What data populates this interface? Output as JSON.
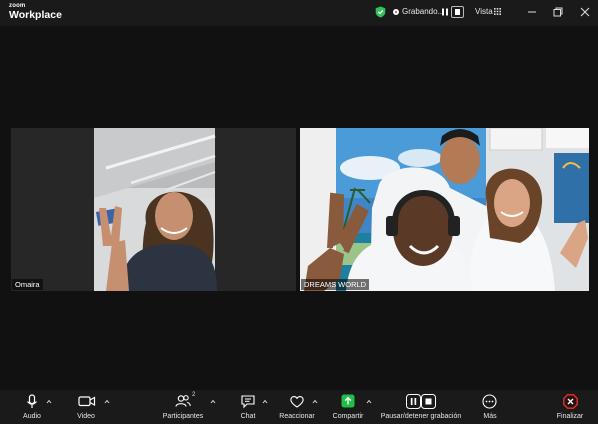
{
  "titlebar": {
    "brand_small": "zoom",
    "brand_big": "Workplace",
    "recording_label": "Grabando...",
    "view_label": "Vista"
  },
  "colors": {
    "shield": "#2fc25b",
    "share_green": "#1fbf4a",
    "end_red": "#e5312b",
    "background": "#1a1a1a"
  },
  "participants": [
    {
      "name": "Omaira"
    },
    {
      "name": "DREAMS WORLD"
    }
  ],
  "toolbar": {
    "audio": "Audio",
    "video": "Video",
    "participants": "Participantes",
    "participants_count": "2",
    "chat": "Chat",
    "react": "Reaccionar",
    "share": "Compartir",
    "record": "Pausar/detener grabación",
    "more": "Más",
    "end": "Finalizar"
  }
}
